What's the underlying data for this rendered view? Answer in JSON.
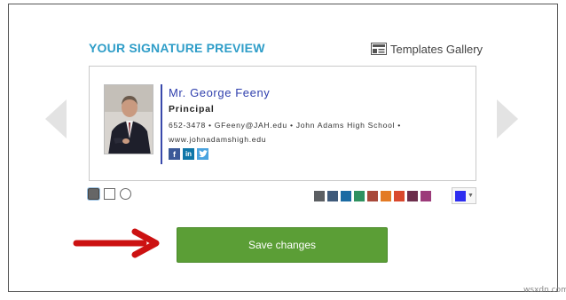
{
  "header": {
    "title": "YOUR SIGNATURE PREVIEW",
    "templates_link": "Templates Gallery",
    "templates_icon": "templates-gallery-icon"
  },
  "signature": {
    "name": "Mr. George Feeny",
    "role": "Principal",
    "contact": "652-3478 • GFeeny@JAH.edu • John Adams High School •",
    "website": "www.johnadamshigh.edu",
    "photo_icon": "profile-photo",
    "divider_color": "#3949ab",
    "socials": [
      {
        "name": "facebook-icon",
        "glyph": "f",
        "color": "#3b5998"
      },
      {
        "name": "linkedin-icon",
        "glyph": "in",
        "color": "#0e76a8"
      },
      {
        "name": "twitter-icon",
        "glyph": "t",
        "color": "#4aa3df"
      }
    ]
  },
  "navigation": {
    "prev_icon": "chevron-left-icon",
    "next_icon": "chevron-right-icon"
  },
  "layout_options": [
    "filled-square",
    "outline-square",
    "outline-circle"
  ],
  "palette": [
    "#5c5f63",
    "#3f5a7a",
    "#1b6ba3",
    "#2f9160",
    "#a8483a",
    "#e37a24",
    "#d9482d",
    "#6d2e4c",
    "#9c3b7a"
  ],
  "selected_color": "#2d2df0",
  "actions": {
    "save_label": "Save changes",
    "save_color": "#5b9e36",
    "arrow_color": "#cc1111"
  },
  "watermark": "wsxdn.com"
}
